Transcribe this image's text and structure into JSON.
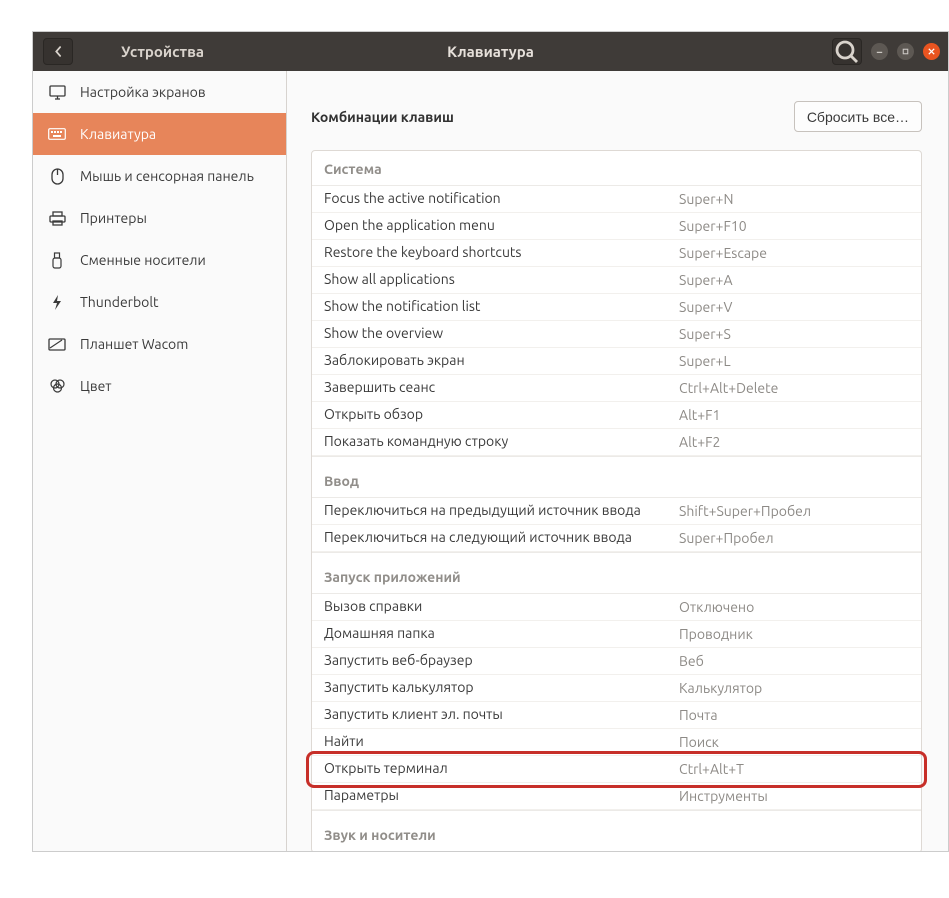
{
  "title_left": "Устройства",
  "title_center": "Клавиатура",
  "sidebar": [
    {
      "id": "displays",
      "label": "Настройка экранов",
      "icon": "display"
    },
    {
      "id": "keyboard",
      "label": "Клавиатура",
      "icon": "keyboard",
      "active": true
    },
    {
      "id": "mouse",
      "label": "Мышь и сенсорная панель",
      "icon": "mouse"
    },
    {
      "id": "printers",
      "label": "Принтеры",
      "icon": "printer"
    },
    {
      "id": "removable",
      "label": "Сменные носители",
      "icon": "usb"
    },
    {
      "id": "thunderbolt",
      "label": "Thunderbolt",
      "icon": "thunderbolt"
    },
    {
      "id": "wacom",
      "label": "Планшет Wacom",
      "icon": "tablet"
    },
    {
      "id": "color",
      "label": "Цвет",
      "icon": "color"
    }
  ],
  "page": {
    "title": "Комбинации клавиш",
    "reset_label": "Сбросить все…"
  },
  "sections": [
    {
      "title": "Система",
      "rows": [
        {
          "label": "Focus the active notification",
          "shortcut": "Super+N"
        },
        {
          "label": "Open the application menu",
          "shortcut": "Super+F10"
        },
        {
          "label": "Restore the keyboard shortcuts",
          "shortcut": "Super+Escape"
        },
        {
          "label": "Show all applications",
          "shortcut": "Super+A"
        },
        {
          "label": "Show the notification list",
          "shortcut": "Super+V"
        },
        {
          "label": "Show the overview",
          "shortcut": "Super+S"
        },
        {
          "label": "Заблокировать экран",
          "shortcut": "Super+L"
        },
        {
          "label": "Завершить сеанс",
          "shortcut": "Ctrl+Alt+Delete"
        },
        {
          "label": "Открыть обзор",
          "shortcut": "Alt+F1"
        },
        {
          "label": "Показать командную строку",
          "shortcut": "Alt+F2"
        }
      ]
    },
    {
      "title": "Ввод",
      "rows": [
        {
          "label": "Переключиться на предыдущий источник ввода",
          "shortcut": "Shift+Super+Пробел"
        },
        {
          "label": "Переключиться на следующий источник ввода",
          "shortcut": "Super+Пробел"
        }
      ]
    },
    {
      "title": "Запуск приложений",
      "rows": [
        {
          "label": "Вызов справки",
          "shortcut": "Отключено"
        },
        {
          "label": "Домашняя папка",
          "shortcut": "Проводник"
        },
        {
          "label": "Запустить веб-браузер",
          "shortcut": "Веб"
        },
        {
          "label": "Запустить калькулятор",
          "shortcut": "Калькулятор"
        },
        {
          "label": "Запустить клиент эл. почты",
          "shortcut": "Почта"
        },
        {
          "label": "Найти",
          "shortcut": "Поиск"
        },
        {
          "label": "Открыть терминал",
          "shortcut": "Ctrl+Alt+T",
          "highlight": true
        },
        {
          "label": "Параметры",
          "shortcut": "Инструменты"
        }
      ]
    },
    {
      "title": "Звук и носители",
      "rows": []
    }
  ]
}
